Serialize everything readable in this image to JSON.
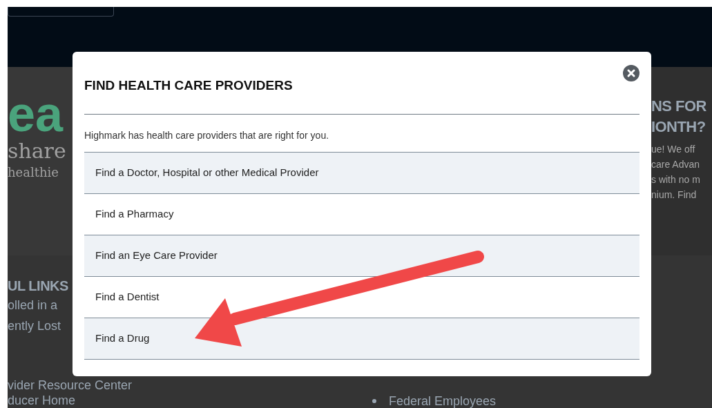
{
  "background": {
    "hero": {
      "wordmark": "ea",
      "tagline": "share",
      "subline": "healthie"
    },
    "promo": {
      "heading": [
        "NS FOR",
        "IONTH?"
      ],
      "lines": [
        "ue! We off",
        "care Advan",
        "s with no m",
        "nium. Find"
      ]
    },
    "links_heading": "UL LINKS",
    "links": [
      "olled in a",
      "ently Lost",
      "vider Resource Center",
      "ducer Home"
    ],
    "audience_links": [
      "Federal Employees"
    ]
  },
  "modal": {
    "title": "FIND HEALTH CARE PROVIDERS",
    "intro": "Highmark has health care providers that are right for you.",
    "items": [
      {
        "label": "Find a Doctor, Hospital or other Medical Provider"
      },
      {
        "label": "Find a Pharmacy"
      },
      {
        "label": "Find an Eye Care Provider"
      },
      {
        "label": "Find a Dentist"
      },
      {
        "label": "Find a Drug"
      }
    ]
  }
}
